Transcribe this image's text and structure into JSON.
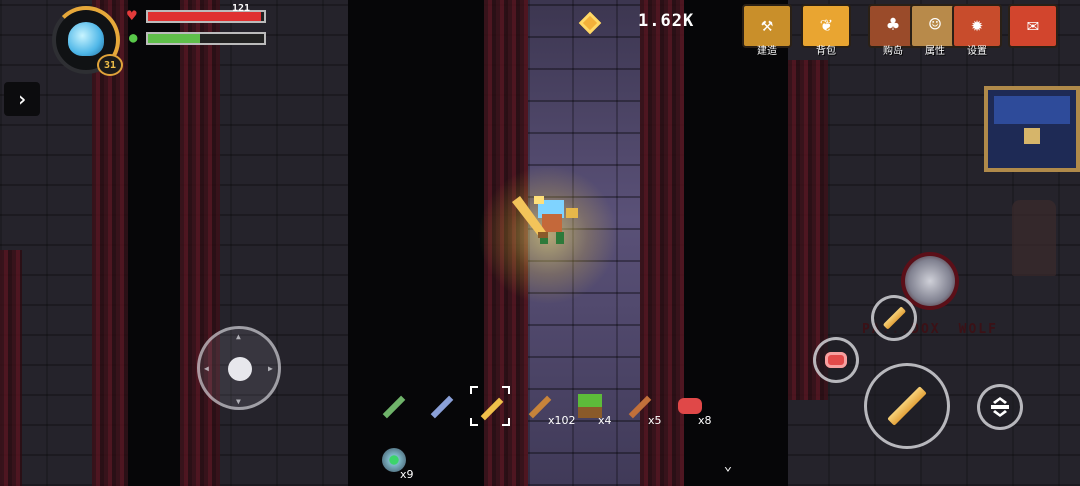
{
  "hud": {
    "level": "31",
    "hp_value": "121",
    "hp_fraction": 0.97,
    "energy_fraction": 0.45,
    "currency_amount": "1.62K"
  },
  "menu": [
    {
      "id": "build",
      "label": "建造",
      "icon": "hammer-anvil-icon",
      "color": "#c98f2a"
    },
    {
      "id": "bag",
      "label": "背包",
      "icon": "backpack-icon",
      "color": "#e9a531"
    },
    {
      "id": "buy-island",
      "label": "购岛",
      "icon": "island-icon",
      "color": "#9a4b2a"
    },
    {
      "id": "stats",
      "label": "属性",
      "icon": "portrait-icon",
      "color": "#b88a4a"
    },
    {
      "id": "settings",
      "label": "设置",
      "icon": "gear-icon",
      "color": "#c84c2c"
    },
    {
      "id": "map",
      "label": "",
      "icon": "scroll-map-icon",
      "color": "#d2452d"
    }
  ],
  "hotbar": [
    {
      "icon": "pickaxe-icon",
      "count": ""
    },
    {
      "icon": "shovel-icon",
      "count": ""
    },
    {
      "icon": "golden-sword-icon",
      "count": "",
      "selected": true
    },
    {
      "icon": "bow-icon",
      "count": "x102"
    },
    {
      "icon": "grass-block-icon",
      "count": "x4"
    },
    {
      "icon": "drumstick-icon",
      "count": "x5"
    },
    {
      "icon": "raw-meat-icon",
      "count": "x8"
    },
    {
      "icon": "orb-icon",
      "count": "x9"
    }
  ],
  "enemy_label": [
    "PA...DOX",
    "WOLF"
  ]
}
